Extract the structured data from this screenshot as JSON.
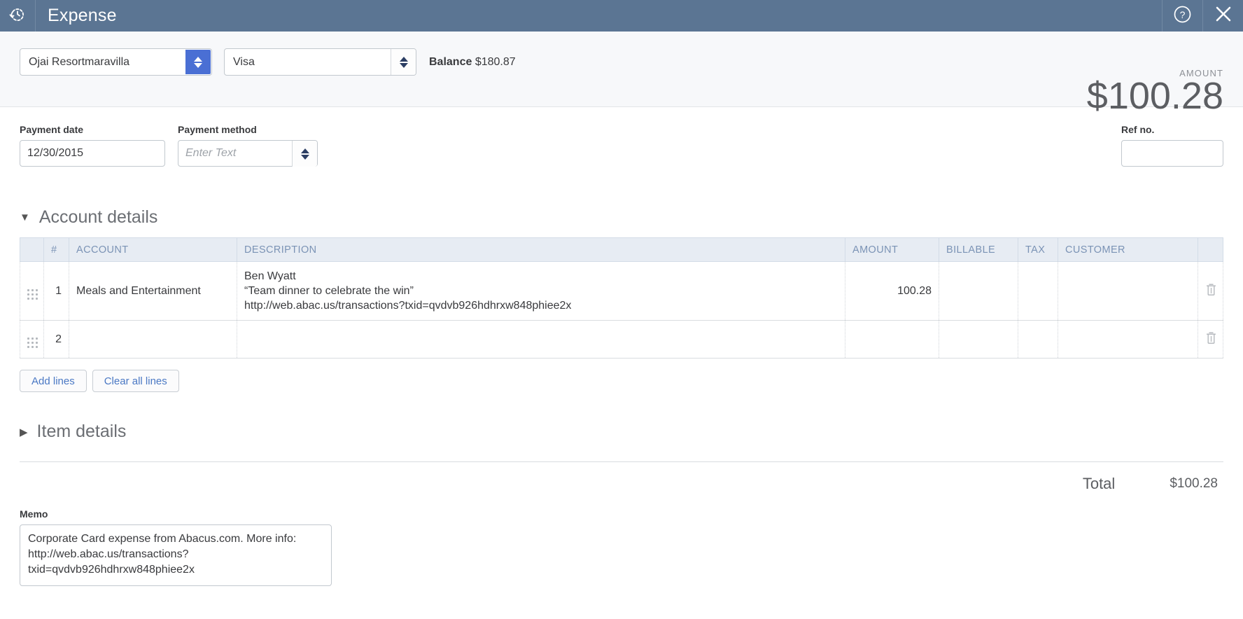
{
  "titlebar": {
    "logo_icon": "clock-arrow-icon",
    "title": "Expense",
    "help_icon": "help-circle-icon",
    "close_icon": "close-icon",
    "bg_color": "#5b7593"
  },
  "summary": {
    "payee": "Ojai Resortmaravilla",
    "account": "Visa",
    "balance_label": "Balance",
    "balance_value": "$180.87",
    "amount_label": "AMOUNT",
    "amount_value": "$100.28",
    "focus_color": "#4a6fd4"
  },
  "fields": {
    "payment_date_label": "Payment date",
    "payment_date_value": "12/30/2015",
    "payment_method_label": "Payment method",
    "payment_method_placeholder": "Enter Text",
    "payment_method_value": "",
    "ref_no_label": "Ref no.",
    "ref_no_value": ""
  },
  "account_details": {
    "heading": "Account details",
    "expanded_marker": "▼",
    "columns": {
      "num": "#",
      "account": "ACCOUNT",
      "description": "DESCRIPTION",
      "amount": "AMOUNT",
      "billable": "BILLABLE",
      "tax": "TAX",
      "customer": "CUSTOMER"
    },
    "rows": [
      {
        "num": "1",
        "account": "Meals and Entertainment",
        "description_lines": [
          "Ben Wyatt",
          "“Team dinner to celebrate the win”",
          "http://web.abac.us/transactions?txid=qvdvb926hdhrxw848phiee2x"
        ],
        "amount": "100.28",
        "billable": "",
        "tax": "",
        "customer": ""
      },
      {
        "num": "2",
        "account": "",
        "description_lines": [],
        "amount": "",
        "billable": "",
        "tax": "",
        "customer": ""
      }
    ],
    "add_lines_label": "Add lines",
    "clear_lines_label": "Clear all lines"
  },
  "item_details": {
    "heading": "Item details",
    "collapsed_marker": "▶"
  },
  "totals": {
    "label": "Total",
    "value": "$100.28"
  },
  "memo": {
    "label": "Memo",
    "value": "Corporate Card expense from Abacus.com. More info: http://web.abac.us/transactions?txid=qvdvb926hdhrxw848phiee2x"
  }
}
